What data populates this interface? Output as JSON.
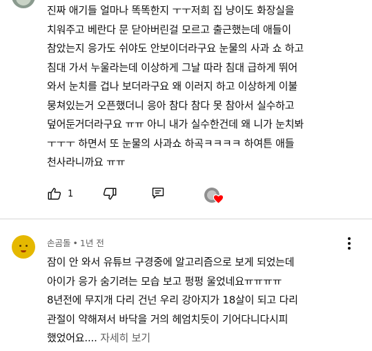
{
  "comment1": {
    "lines": [
      "진짜 애기들 얼마나 똑똑한지 ㅜㅜ저희 집 냥이도 화장실을",
      "치워주고 베란다 문 닫아버린걸 모르고 출근했는데 애들이",
      "참았는지 응가도 쉬야도 안보이더라구요 눈물의 사과 쇼 하고",
      "침대 가서 누울라는데 이상하게 그날 따라 침대 급하게 뛰어",
      "와서 눈치를 겁나 보더라구요 왜 이러지 하고 이상하게 이불",
      "뭉쳐있는거 오픈했더니 응아 참다 참다 못 참아서 실수하고",
      "덮어둔거더라구요 ㅠㅠ 아니 내가 실수한건데 왜 니가 눈치봐",
      "ㅜㅜㅜ 하면서 또 눈물의 사과쇼 하곡ㅋㅋㅋㅋ 하여튼 애들",
      "천사라니까요 ㅠㅠ"
    ],
    "like_count": "1",
    "icons": [
      "thumb-up-icon",
      "thumb-down-icon",
      "reply-icon",
      "creator-heart-icon"
    ]
  },
  "comment2": {
    "author": "손곰돌",
    "separator": "•",
    "time": "1년 전",
    "lines": [
      "잠이 안 와서 유튜브 구경중에 알고리즘으로 보게 되었는데",
      "아이가 응가 숨기려는 모습 보고 펑펑 울었네요ㅠㅠㅠㅠ",
      "8년전에 무지개 다리 건넌 우리 강아지가 18살이 되고 다리",
      "관절이 약해져서 바닥을 거의 헤엄치듯이 기어다니다시피"
    ],
    "last_line": "했었어요....",
    "read_more": "자세히 보기",
    "icons": [
      "more-vert-icon"
    ]
  },
  "colors": {
    "text": "#0f0f0f",
    "secondary": "#606060",
    "heart": "#ff0000",
    "divider": "#d6d6d6"
  }
}
